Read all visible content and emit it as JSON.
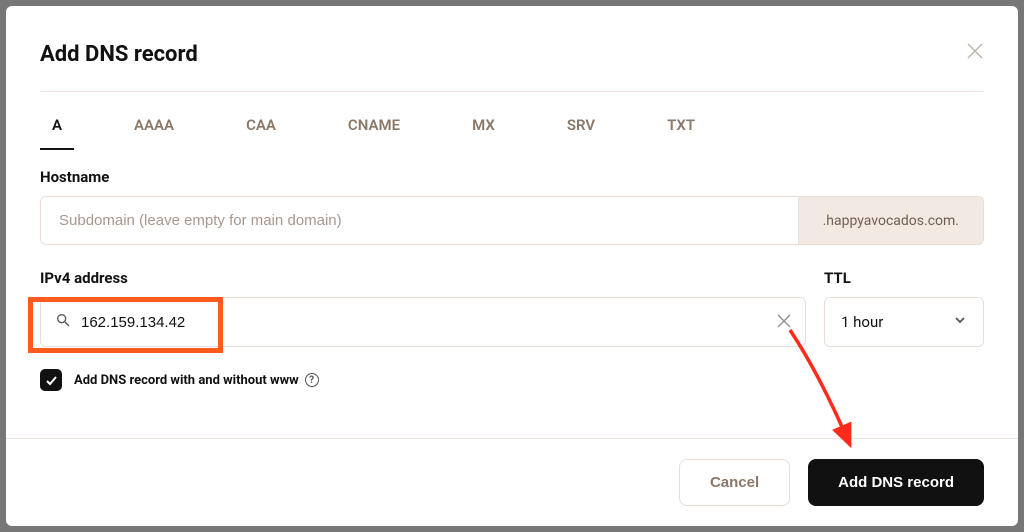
{
  "modal": {
    "title": "Add DNS record"
  },
  "tabs": [
    "A",
    "AAAA",
    "CAA",
    "CNAME",
    "MX",
    "SRV",
    "TXT"
  ],
  "hostname": {
    "label": "Hostname",
    "placeholder": "Subdomain (leave empty for main domain)",
    "suffix": ".happyavocados.com."
  },
  "ipv4": {
    "label": "IPv4 address",
    "value": "162.159.134.42"
  },
  "ttl": {
    "label": "TTL",
    "value": "1 hour"
  },
  "checkbox": {
    "label": "Add DNS record with and without www",
    "checked": true
  },
  "buttons": {
    "cancel": "Cancel",
    "submit": "Add DNS record"
  }
}
